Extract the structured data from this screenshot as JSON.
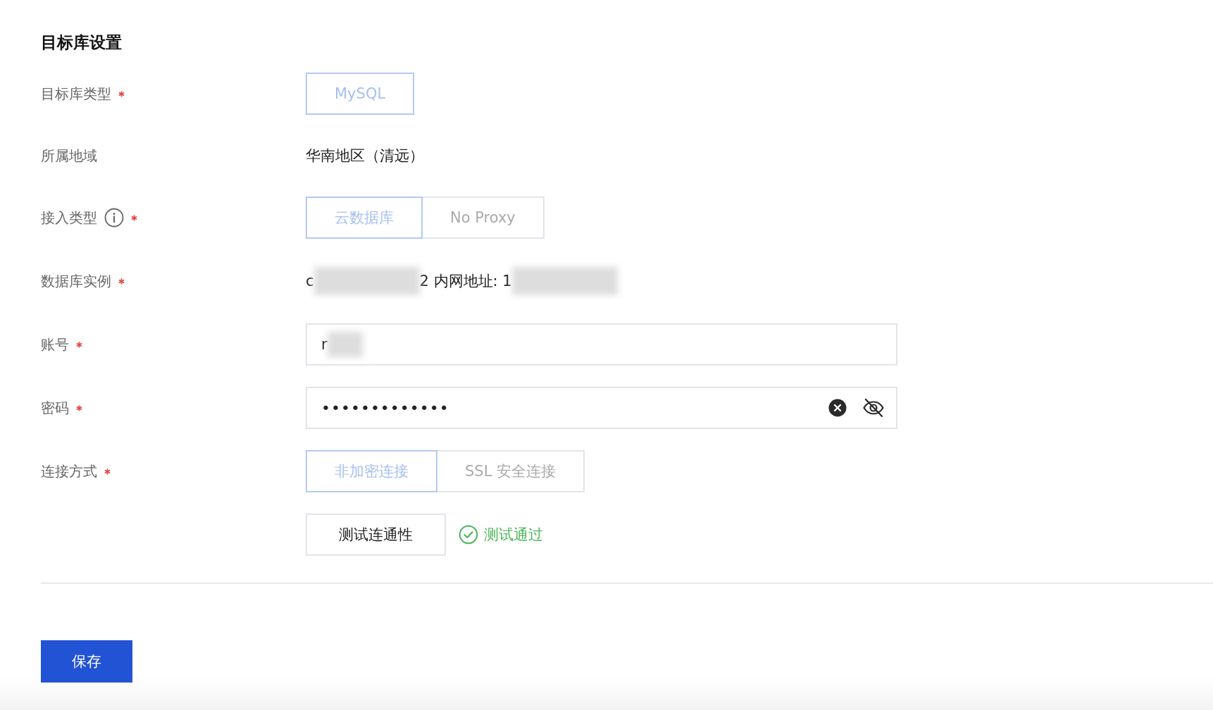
{
  "section_title": "目标库设置",
  "fields": [
    {
      "kind": "segmented",
      "label": "目标库类型",
      "info": false,
      "required": true,
      "options": [
        {
          "label": "MySQL",
          "selected": true
        }
      ]
    },
    {
      "kind": "text",
      "label": "所属地域",
      "info": false,
      "required": false,
      "value": "华南地区（清远）"
    },
    {
      "kind": "segmented",
      "label": "接入类型",
      "info": true,
      "required": true,
      "options": [
        {
          "label": "云数据库",
          "selected": true
        },
        {
          "label": "No Proxy",
          "selected": false
        }
      ]
    },
    {
      "kind": "instance",
      "label": "数据库实例",
      "info": false,
      "required": true,
      "parts": [
        {
          "kind": "text",
          "text": "c"
        },
        {
          "kind": "redacted"
        },
        {
          "kind": "text",
          "text": "2 内网地址: 1"
        },
        {
          "kind": "redacted"
        }
      ]
    },
    {
      "kind": "input",
      "label": "账号",
      "info": false,
      "required": true,
      "parts": [
        {
          "kind": "text",
          "text": "r"
        },
        {
          "kind": "redacted"
        }
      ]
    },
    {
      "kind": "password",
      "label": "密码",
      "info": false,
      "required": true,
      "value": "•••••••••••••"
    },
    {
      "kind": "segmented",
      "label": "连接方式",
      "info": false,
      "required": true,
      "options": [
        {
          "label": "非加密连接",
          "selected": true
        },
        {
          "label": "SSL 安全连接",
          "selected": false
        }
      ]
    },
    {
      "kind": "test",
      "button": "测试连通性",
      "result": "测试通过"
    }
  ],
  "save_button": "保存"
}
